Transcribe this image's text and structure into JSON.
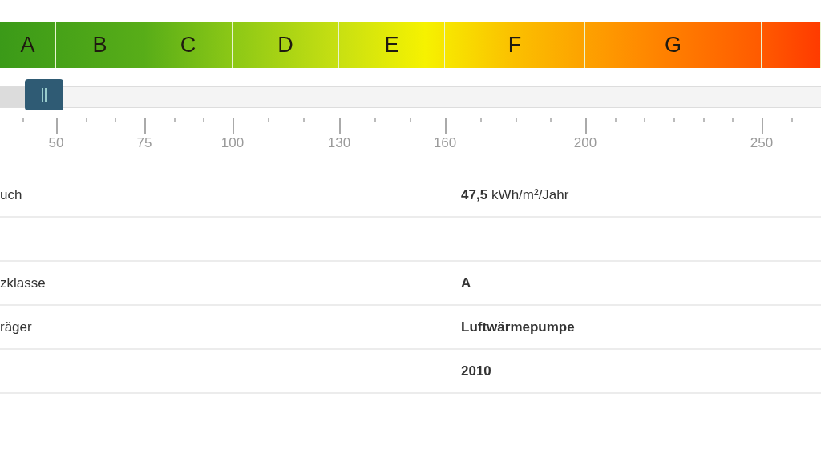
{
  "energy_scale": {
    "bands": [
      {
        "label": "A"
      },
      {
        "label": "B"
      },
      {
        "label": "C"
      },
      {
        "label": "D"
      },
      {
        "label": "E"
      },
      {
        "label": "F"
      },
      {
        "label": "G"
      }
    ],
    "slider": {
      "level": 0.054
    },
    "ticks": [
      "50",
      "75",
      "100",
      "130",
      "160",
      "200",
      "250"
    ]
  },
  "details": [
    {
      "kind": "entry",
      "label": "uch",
      "value": "47,5",
      "unit": "kWh/m²/Jahr"
    },
    {
      "kind": "spacer"
    },
    {
      "kind": "entry",
      "label": "zklasse",
      "value": "A"
    },
    {
      "kind": "entry",
      "label": "räger",
      "value": "Luftwärmepumpe"
    },
    {
      "kind": "entry",
      "value": "2010"
    }
  ]
}
